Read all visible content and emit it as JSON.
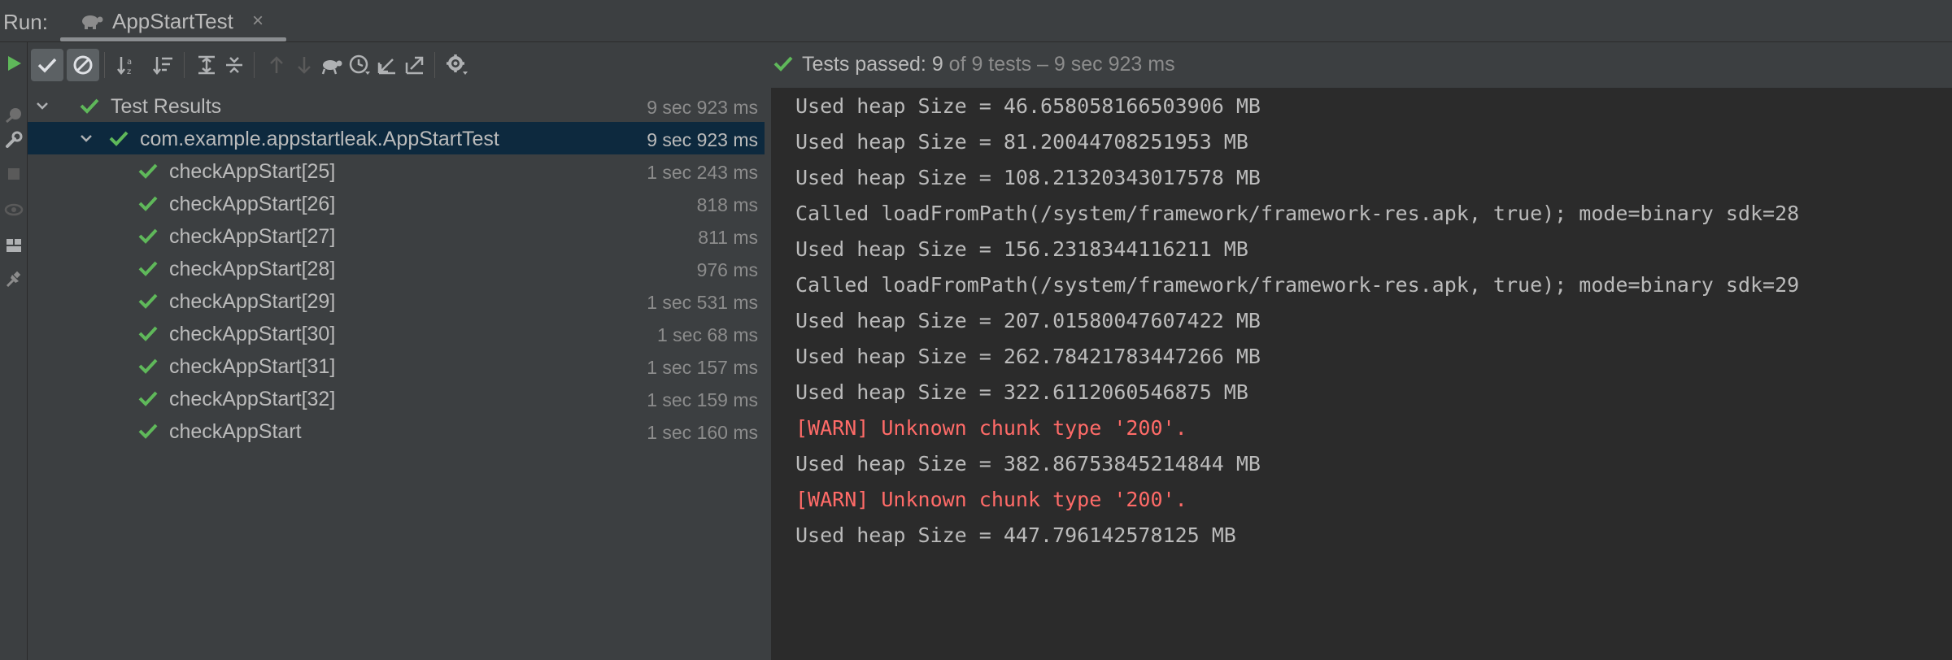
{
  "header": {
    "run_label": "Run:",
    "tab_title": "AppStartTest",
    "close_glyph": "×"
  },
  "toolbar": {
    "buttons": [
      "rerun-icon",
      "show-passed-icon",
      "show-ignored-icon",
      "sort-alpha-icon",
      "sort-duration-icon",
      "expand-all-icon",
      "collapse-all-icon",
      "previous-failed-icon",
      "next-failed-icon",
      "import-tests-icon",
      "history-icon",
      "export-icon",
      "import-icon",
      "settings-icon"
    ]
  },
  "status": {
    "prefix": "Tests passed: ",
    "passed": "9",
    "suffix": " of 9 tests – 9 sec 923 ms"
  },
  "tree": {
    "root": {
      "label": "Test Results",
      "time": "9 sec 923 ms"
    },
    "suite": {
      "label": "com.example.appstartleak.AppStartTest",
      "time": "9 sec 923 ms"
    },
    "tests": [
      {
        "label": "checkAppStart[25]",
        "time": "1 sec 243 ms"
      },
      {
        "label": "checkAppStart[26]",
        "time": "818 ms"
      },
      {
        "label": "checkAppStart[27]",
        "time": "811 ms"
      },
      {
        "label": "checkAppStart[28]",
        "time": "976 ms"
      },
      {
        "label": "checkAppStart[29]",
        "time": "1 sec 531 ms"
      },
      {
        "label": "checkAppStart[30]",
        "time": "1 sec 68 ms"
      },
      {
        "label": "checkAppStart[31]",
        "time": "1 sec 157 ms"
      },
      {
        "label": "checkAppStart[32]",
        "time": "1 sec 159 ms"
      },
      {
        "label": "checkAppStart",
        "time": "1 sec 160 ms"
      }
    ]
  },
  "console": {
    "lines": [
      {
        "text": "Used heap Size = 46.658058166503906 MB",
        "level": "info"
      },
      {
        "text": "Used heap Size = 81.20044708251953 MB",
        "level": "info"
      },
      {
        "text": "Used heap Size = 108.21320343017578 MB",
        "level": "info"
      },
      {
        "text": "Called loadFromPath(/system/framework/framework-res.apk, true); mode=binary sdk=28",
        "level": "info"
      },
      {
        "text": "Used heap Size = 156.2318344116211 MB",
        "level": "info"
      },
      {
        "text": "Called loadFromPath(/system/framework/framework-res.apk, true); mode=binary sdk=29",
        "level": "info"
      },
      {
        "text": "Used heap Size = 207.01580047607422 MB",
        "level": "info"
      },
      {
        "text": "Used heap Size = 262.78421783447266 MB",
        "level": "info"
      },
      {
        "text": "Used heap Size = 322.6112060546875 MB",
        "level": "info"
      },
      {
        "text": "[WARN] Unknown chunk type '200'.",
        "level": "warn"
      },
      {
        "text": "Used heap Size = 382.86753845214844 MB",
        "level": "info"
      },
      {
        "text": "[WARN] Unknown chunk type '200'.",
        "level": "warn"
      },
      {
        "text": "Used heap Size = 447.796142578125 MB",
        "level": "info"
      }
    ]
  },
  "colors": {
    "pass_green": "#5fb85a",
    "warn_red": "#ff6b68",
    "selected_row": "#0d293e",
    "console_bg": "#2b2b2b",
    "panel_bg": "#3c3f41"
  }
}
